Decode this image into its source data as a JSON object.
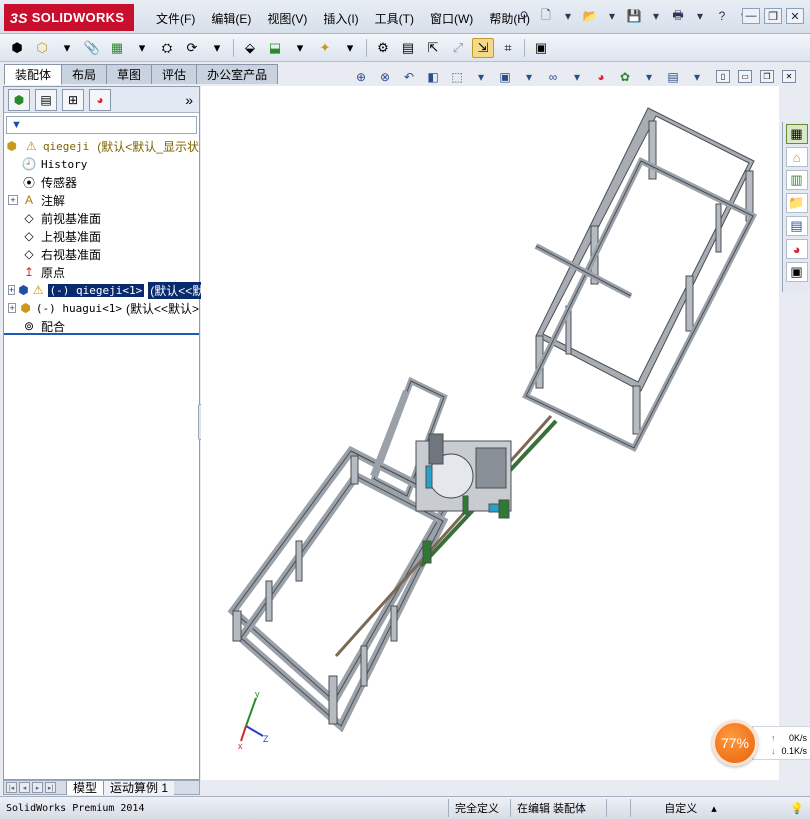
{
  "app": {
    "logo_ds": "3S",
    "logo_text": "SOLIDWORKS"
  },
  "menu": [
    "文件(F)",
    "编辑(E)",
    "视图(V)",
    "插入(I)",
    "工具(T)",
    "窗口(W)",
    "帮助(H)"
  ],
  "command_tabs": [
    {
      "label": "装配体",
      "active": true
    },
    {
      "label": "布局",
      "active": false
    },
    {
      "label": "草图",
      "active": false
    },
    {
      "label": "评估",
      "active": false
    },
    {
      "label": "办公室产品",
      "active": false
    }
  ],
  "feature_tree": {
    "root": {
      "name": "qiegeji",
      "config": "(默认<默认_显示状"
    },
    "items": [
      {
        "label": "History",
        "mono": true,
        "expander": false,
        "icon": "history-icon"
      },
      {
        "label": "传感器",
        "mono": false,
        "expander": false,
        "icon": "sensor-icon"
      },
      {
        "label": "注解",
        "mono": false,
        "expander": true,
        "icon": "annotation-icon"
      },
      {
        "label": "前视基准面",
        "mono": false,
        "expander": false,
        "icon": "plane-icon"
      },
      {
        "label": "上视基准面",
        "mono": false,
        "expander": false,
        "icon": "plane-icon"
      },
      {
        "label": "右视基准面",
        "mono": false,
        "expander": false,
        "icon": "plane-icon"
      },
      {
        "label": "原点",
        "mono": false,
        "expander": false,
        "icon": "origin-icon"
      }
    ],
    "component_1": {
      "name": "(-) qiegeji<1>",
      "config": "(默认<<默"
    },
    "component_2": {
      "name": "(-) huagui<1>",
      "config": "(默认<<默认>"
    },
    "mates": "配合"
  },
  "bottom_tabs": [
    "模型",
    "运动算例 1"
  ],
  "speed": {
    "percent": "77%",
    "up": "0K/s",
    "down": "0.1K/s"
  },
  "status": {
    "product": "SolidWorks Premium 2014",
    "definition": "完全定义",
    "editing": "在编辑 装配体",
    "units": "自定义"
  },
  "colors": {
    "brand": "#c8102e",
    "selection": "#0a2a6e",
    "frame": "#9aa1a8"
  }
}
